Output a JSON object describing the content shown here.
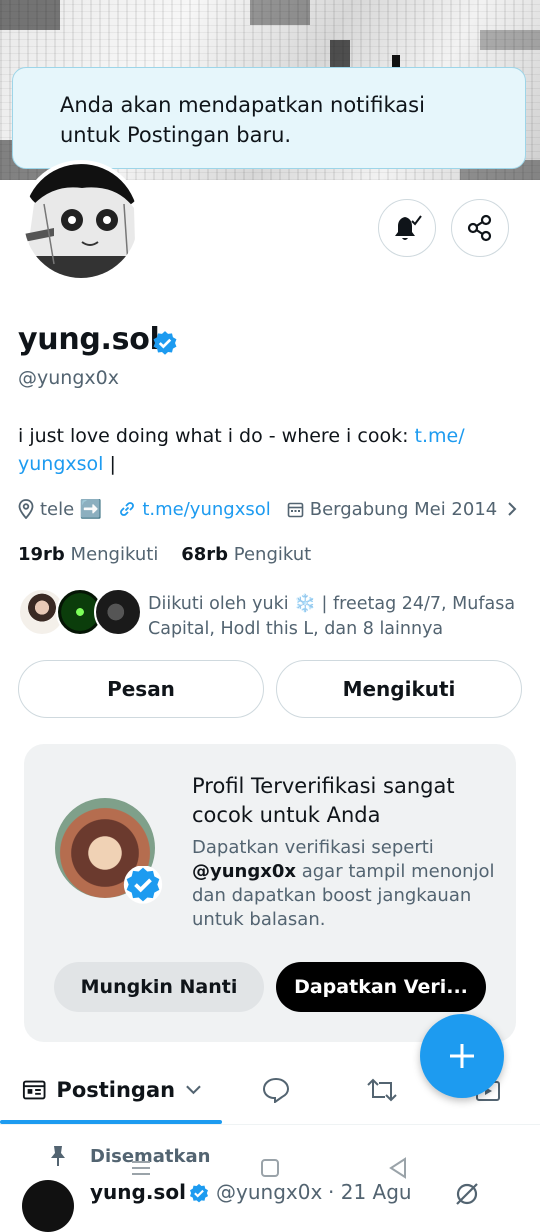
{
  "toast": {
    "message": "Anda akan mendapatkan notifikasi untuk Postingan baru."
  },
  "profile": {
    "name": "yung.sol",
    "handle": "@yungx0x",
    "bio_text": "i just love doing what i do - where i cook: ",
    "bio_link": "t.me/ yungxsol",
    "bio_suffix": " |",
    "location": "tele ➡️",
    "website": "t.me/yungxsol",
    "joined": "Bergabung Mei 2014",
    "following_count": "19rb",
    "following_label": "Mengikuti",
    "followers_count": "68rb",
    "followers_label": "Pengikut",
    "followed_by": "Diikuti oleh yuki ❄️ | freetag 24/7, Mufasa Capital, Hodl this L, dan 8 lainnya"
  },
  "actions": {
    "message_label": "Pesan",
    "following_label": "Mengikuti"
  },
  "verify_card": {
    "title": "Profil Terverifikasi sangat cocok untuk Anda",
    "desc_prefix": "Dapatkan verifikasi seperti ",
    "desc_handle": "@yungx0x",
    "desc_suffix": " agar tampil menonjol dan dapatkan boost jangkauan untuk balasan.",
    "later_label": "Mungkin Nanti",
    "get_label": "Dapatkan Veri..."
  },
  "tabs": {
    "posts_label": "Postingan"
  },
  "pinned_post": {
    "pinned_label": "Disematkan",
    "author_name": "yung.sol",
    "author_handle": "@yungx0x",
    "date": "· 21 Agu"
  },
  "colors": {
    "accent": "#1d9bf0",
    "text": "#0f1419",
    "muted": "#536471",
    "toast_bg": "#e6f6fb"
  },
  "icons": [
    "bell-check-icon",
    "share-icon",
    "verified-badge-icon",
    "location-icon",
    "link-icon",
    "calendar-icon",
    "chevron-right-icon",
    "plus-icon",
    "posts-icon",
    "chevron-down-icon",
    "reply-icon",
    "repost-icon",
    "media-icon",
    "pin-icon",
    "grok-icon",
    "menu-nav-icon",
    "home-nav-icon",
    "back-nav-icon"
  ]
}
